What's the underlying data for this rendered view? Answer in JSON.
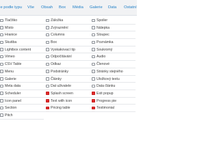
{
  "tabs": [
    {
      "label": "Dle podle typu"
    },
    {
      "label": "Vše"
    },
    {
      "label": "Obsah"
    },
    {
      "label": "Box"
    },
    {
      "label": "Média"
    },
    {
      "label": "Galerie"
    },
    {
      "label": "Data"
    },
    {
      "label": "Ostatní"
    }
  ],
  "columns": [
    {
      "items": [
        {
          "label": "Tlačítko",
          "icon": "button-icon"
        },
        {
          "label": "Místo",
          "icon": "location-icon"
        },
        {
          "label": "Hranice",
          "icon": "border-icon"
        },
        {
          "label": "Skutiba",
          "icon": "grid-icon"
        },
        {
          "label": "Lightbox content",
          "icon": "lightbox-icon"
        },
        {
          "label": "Vimeo",
          "icon": "video-icon"
        },
        {
          "label": "CSV Table",
          "icon": "table-icon"
        },
        {
          "label": "Menu",
          "icon": "menu-icon"
        },
        {
          "label": "Galerie",
          "icon": "gallery-icon"
        },
        {
          "label": "Meta data",
          "icon": "meta-icon"
        },
        {
          "label": "Scheduler",
          "icon": "calendar-icon"
        },
        {
          "label": "Icon panel",
          "icon": "icon-panel-icon"
        },
        {
          "label": "Section",
          "icon": "section-icon"
        },
        {
          "label": "Pitch",
          "icon": "pitch-icon"
        }
      ]
    },
    {
      "items": [
        {
          "label": "Záložka",
          "icon": "tab-icon"
        },
        {
          "label": "Zvýraznění",
          "icon": "highlight-icon"
        },
        {
          "label": "Columns",
          "icon": "columns-icon"
        },
        {
          "label": "Box",
          "icon": "box-icon"
        },
        {
          "label": "Vyskakovací tip",
          "icon": "tooltip-icon"
        },
        {
          "label": "Odpočítávání",
          "icon": "countdown-icon"
        },
        {
          "label": "Odkaz",
          "icon": "link-icon"
        },
        {
          "label": "Podstránky",
          "icon": "subpages-icon"
        },
        {
          "label": "Články",
          "icon": "posts-icon"
        },
        {
          "label": "Dat uživatele",
          "icon": "user-data-icon"
        },
        {
          "label": "Splash screen",
          "icon": "splash-icon",
          "accent": true
        },
        {
          "label": "Text with icon",
          "icon": "text-icon",
          "accent": true
        },
        {
          "label": "Pricing table",
          "icon": "pricing-icon",
          "accent": true
        }
      ]
    },
    {
      "items": [
        {
          "label": "Spoiler",
          "icon": "spoiler-icon"
        },
        {
          "label": "Nálepka",
          "icon": "label-icon"
        },
        {
          "label": "Sloupec",
          "icon": "column-icon"
        },
        {
          "label": "Poznámka",
          "icon": "note-icon"
        },
        {
          "label": "Soukromý",
          "icon": "private-icon"
        },
        {
          "label": "Audio",
          "icon": "audio-icon"
        },
        {
          "label": "Členové",
          "icon": "members-icon"
        },
        {
          "label": "Stránky stejného",
          "icon": "siblings-icon"
        },
        {
          "label": "Uložkový textu",
          "icon": "text-excerpt-icon"
        },
        {
          "label": "Data článku",
          "icon": "post-data-icon"
        },
        {
          "label": "Exit popup",
          "icon": "exit-popup-icon",
          "accent": true
        },
        {
          "label": "Progress pie",
          "icon": "progress-pie-icon",
          "accent": true
        },
        {
          "label": "Testimonial",
          "icon": "testimonial-icon",
          "accent": true
        }
      ]
    }
  ]
}
